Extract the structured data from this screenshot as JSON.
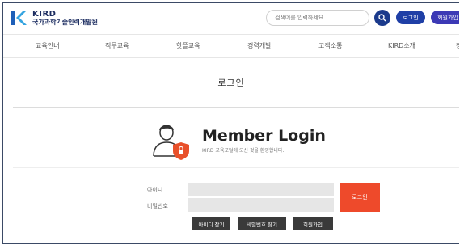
{
  "header": {
    "logo_en": "KIRD",
    "logo_ko": "국가과학기술인력개발원",
    "search_placeholder": "검색어를 입력하세요",
    "login_label": "로그인",
    "join_label": "회원가입"
  },
  "nav": {
    "items": [
      "교육안내",
      "직무교육",
      "핫플교육",
      "경력개발",
      "고객소통",
      "KIRD소개",
      "정"
    ]
  },
  "page": {
    "title": "로그인"
  },
  "login": {
    "heading": "Member Login",
    "subheading": "KIRD 교육포털에 오신 것을 환영합니다.",
    "id_label": "아이디",
    "password_label": "비밀번호",
    "submit_label": "로그인",
    "find_id_label": "아이디 찾기",
    "find_password_label": "비밀번호 찾기",
    "signup_label": "회원가입"
  },
  "colors": {
    "brand_navy": "#1b3a8c",
    "login_pill": "#1f3fa6",
    "join_pill": "#3c39b5",
    "submit_orange": "#ee4a2b",
    "shield_orange": "#e8502a"
  },
  "icons": {
    "logo": "kird-logo-icon",
    "search": "search-icon",
    "person": "person-shield-icon"
  }
}
